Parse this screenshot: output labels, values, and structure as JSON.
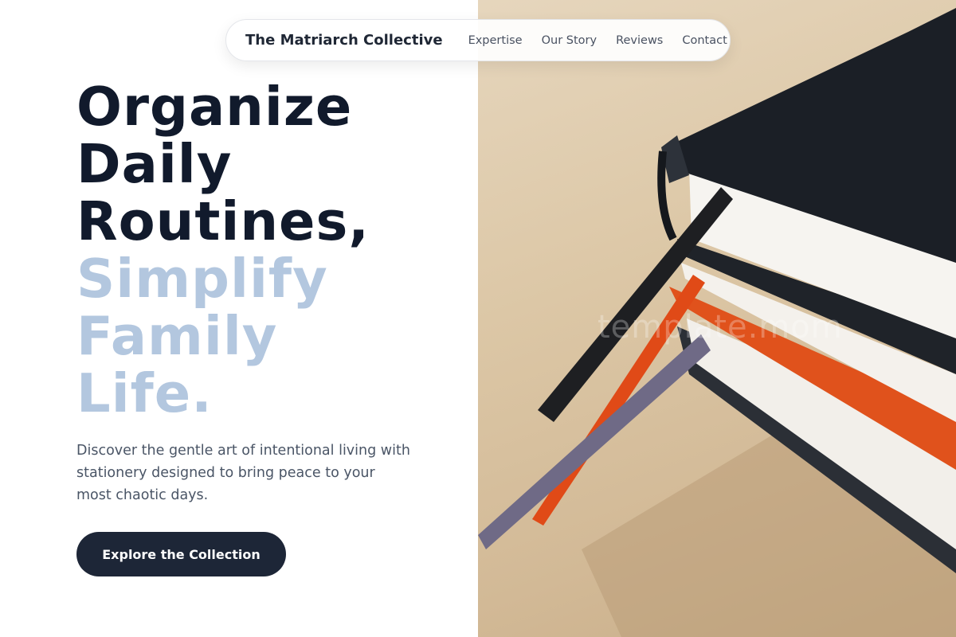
{
  "nav": {
    "brand": "The Matriarch Collective",
    "links": [
      "Expertise",
      "Our Story",
      "Reviews",
      "Contact"
    ]
  },
  "hero": {
    "headline_dark": [
      "Organize",
      "Daily",
      "Routines,"
    ],
    "headline_light": [
      "Simplify",
      "Family",
      "Life."
    ],
    "subtitle": "Discover the gentle art of intentional living with stationery designed to bring peace to your most chaotic days.",
    "cta_label": "Explore the Collection"
  },
  "image": {
    "watermark": "template.mom"
  },
  "colors": {
    "headline_dark": "#111a2c",
    "headline_light": "#b3c7df",
    "cta_background": "#1d2637",
    "photo_background": "#dcc7a6"
  }
}
